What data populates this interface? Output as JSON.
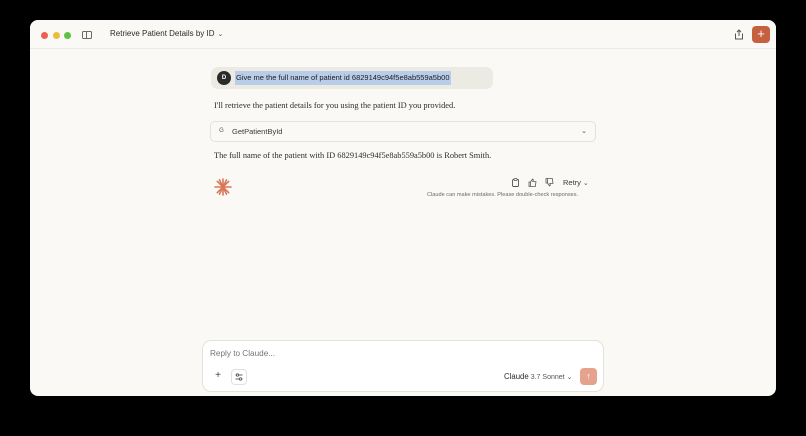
{
  "window": {
    "title": "Retrieve Patient Details by ID",
    "new_chat_label": "+"
  },
  "conversation": {
    "user": {
      "avatar_initial": "D",
      "message": "Give me the full name of patient id 6829149c94f5e8ab559a5b00"
    },
    "assistant": {
      "intro": "I'll retrieve the patient details for you using the patient ID you provided.",
      "tool_call": {
        "icon_letter": "G",
        "name": "GetPatientById"
      },
      "answer": "The full name of the patient with ID 6829149c94f5e8ab559a5b00 is Robert Smith."
    },
    "actions": {
      "retry_label": "Retry",
      "disclaimer": "Claude can make mistakes. Please double-check responses."
    }
  },
  "composer": {
    "placeholder": "Reply to Claude...",
    "add_label": "+",
    "model_name": "Claude",
    "model_version": "3.7 Sonnet"
  },
  "colors": {
    "accent": "#c6613f",
    "background": "#faf9f5",
    "selection": "#b9cdea",
    "send_disabled": "#e5a38d"
  },
  "icons": [
    "sidebar-toggle-icon",
    "chevron-down-icon",
    "share-icon",
    "plus-icon",
    "claude-spark-icon",
    "copy-icon",
    "thumbs-up-icon",
    "thumbs-down-icon",
    "tools-icon",
    "arrow-up-icon"
  ]
}
